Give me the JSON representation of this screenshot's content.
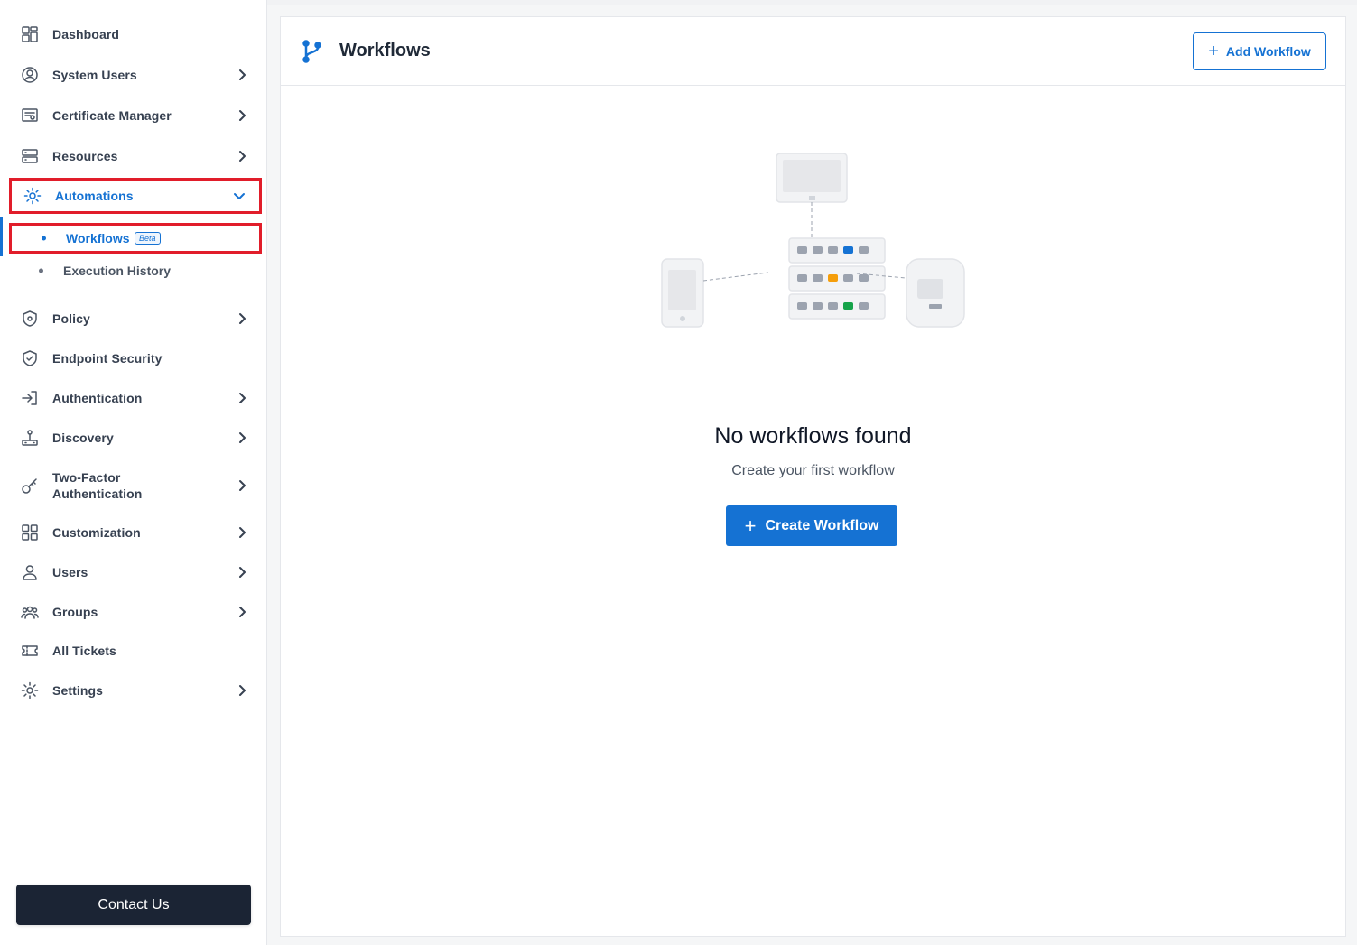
{
  "sidebar": {
    "items": [
      {
        "label": "Dashboard"
      },
      {
        "label": "System Users"
      },
      {
        "label": "Certificate Manager"
      },
      {
        "label": "Resources"
      },
      {
        "label": "Automations"
      },
      {
        "label": "Policy"
      },
      {
        "label": "Endpoint Security"
      },
      {
        "label": "Authentication"
      },
      {
        "label": "Discovery"
      },
      {
        "label": "Two-Factor\nAuthentication"
      },
      {
        "label": "Customization"
      },
      {
        "label": "Users"
      },
      {
        "label": "Groups"
      },
      {
        "label": "All Tickets"
      },
      {
        "label": "Settings"
      }
    ],
    "subitems": [
      {
        "label": "Workflows",
        "badge": "Beta"
      },
      {
        "label": "Execution History"
      }
    ],
    "contact_label": "Contact Us"
  },
  "header": {
    "title": "Workflows",
    "add_button_label": "Add Workflow"
  },
  "empty_state": {
    "title": "No workflows found",
    "subtitle": "Create your first workflow",
    "button_label": "Create Workflow"
  },
  "colors": {
    "accent": "#1572d3",
    "highlight": "#e11d2a",
    "contact_bg": "#1b2434"
  }
}
